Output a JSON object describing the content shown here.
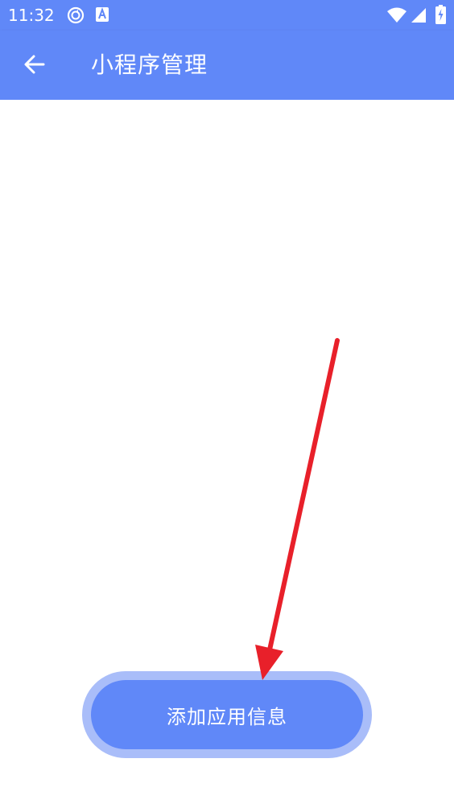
{
  "status_bar": {
    "time": "11:32",
    "icons": [
      "sync-circle-icon",
      "text-a-icon",
      "wifi-icon",
      "signal-icon",
      "battery-charging-icon"
    ]
  },
  "app_bar": {
    "back_icon": "arrow-left-icon",
    "title": "小程序管理"
  },
  "main": {
    "add_button_label": "添加应用信息"
  },
  "colors": {
    "primary": "#6088f8",
    "button_halo": "#a9bdf9",
    "annotation_arrow": "#e8202a",
    "background": "#ffffff"
  }
}
